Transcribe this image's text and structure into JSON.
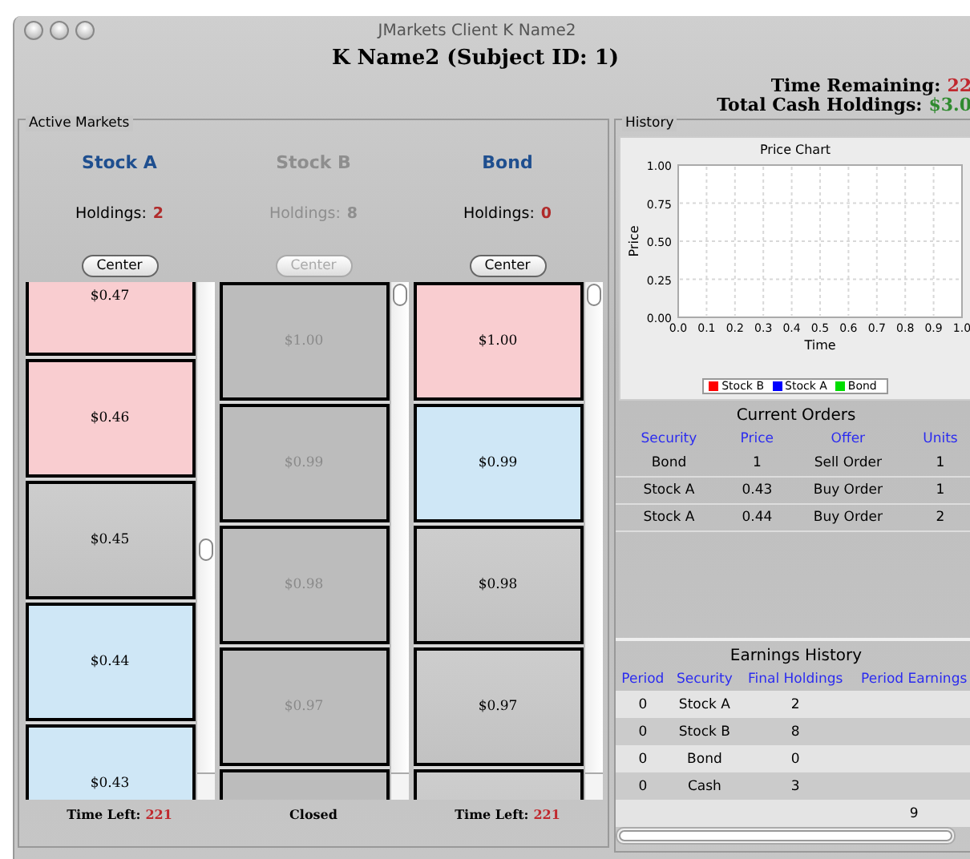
{
  "window": {
    "title": "JMarkets Client K Name2"
  },
  "subject_title": "K Name2 (Subject ID: 1)",
  "time_remaining": {
    "label": "Time Remaining:",
    "value": "22"
  },
  "cash_holdings": {
    "label": "Total Cash Holdings:",
    "value": "$3.0"
  },
  "markets": {
    "title": "Active Markets",
    "columns": [
      {
        "name": "Stock A",
        "disabled": false,
        "holdings_label": "Holdings:",
        "holdings": "2",
        "button": "Center",
        "footer": {
          "kind": "timer",
          "label": "Time Left:",
          "value": "221"
        },
        "cells": [
          {
            "price": "$0.47",
            "kind": "sell"
          },
          {
            "price": "$0.46",
            "kind": "sell"
          },
          {
            "price": "$0.45",
            "kind": "none"
          },
          {
            "price": "$0.44",
            "kind": "buy"
          },
          {
            "price": "$0.43",
            "kind": "buy"
          }
        ]
      },
      {
        "name": "Stock B",
        "disabled": true,
        "holdings_label": "Holdings:",
        "holdings": "8",
        "button": "Center",
        "footer": {
          "kind": "closed",
          "label": "Closed"
        },
        "cells": [
          {
            "price": "$1.00",
            "kind": "none"
          },
          {
            "price": "$0.99",
            "kind": "none"
          },
          {
            "price": "$0.98",
            "kind": "none"
          },
          {
            "price": "$0.97",
            "kind": "none"
          },
          {
            "kind": "none"
          }
        ]
      },
      {
        "name": "Bond",
        "disabled": false,
        "holdings_label": "Holdings:",
        "holdings": "0",
        "button": "Center",
        "footer": {
          "kind": "timer",
          "label": "Time Left:",
          "value": "221"
        },
        "cells": [
          {
            "price": "$1.00",
            "kind": "sell"
          },
          {
            "price": "$0.99",
            "kind": "buy"
          },
          {
            "price": "$0.98",
            "kind": "none"
          },
          {
            "price": "$0.97",
            "kind": "none"
          },
          {
            "kind": "none"
          }
        ]
      }
    ]
  },
  "history": {
    "title": "History",
    "price_chart": {
      "title": "Price Chart",
      "xlabel": "Time",
      "ylabel": "Price",
      "grid": true,
      "x_tick_labels": [
        "0.0",
        "0.1",
        "0.2",
        "0.3",
        "0.4",
        "0.5",
        "0.6",
        "0.7",
        "0.8",
        "0.9",
        "1.0"
      ],
      "y_tick_labels": [
        "1.00",
        "0.75",
        "0.50",
        "0.25",
        "0.00"
      ],
      "legend": [
        {
          "name": "Stock B",
          "color": "#ff0000"
        },
        {
          "name": "Stock A",
          "color": "#0000ff"
        },
        {
          "name": "Bond",
          "color": "#00dd00"
        }
      ]
    },
    "current_orders": {
      "title": "Current Orders",
      "columns": [
        "Security",
        "Price",
        "Offer",
        "Units"
      ],
      "rows": [
        [
          "Bond",
          "1",
          "Sell Order",
          "1"
        ],
        [
          "Stock A",
          "0.43",
          "Buy Order",
          "1"
        ],
        [
          "Stock A",
          "0.44",
          "Buy Order",
          "2"
        ]
      ]
    },
    "earnings_history": {
      "title": "Earnings History",
      "columns": [
        "Period",
        "Security",
        "Final Holdings",
        "Period Earnings"
      ],
      "rows": [
        [
          "0",
          "Stock A",
          "2",
          ""
        ],
        [
          "0",
          "Stock B",
          "8",
          ""
        ],
        [
          "0",
          "Bond",
          "0",
          ""
        ],
        [
          "0",
          "Cash",
          "3",
          ""
        ],
        [
          "",
          "",
          "",
          "9"
        ]
      ]
    }
  }
}
